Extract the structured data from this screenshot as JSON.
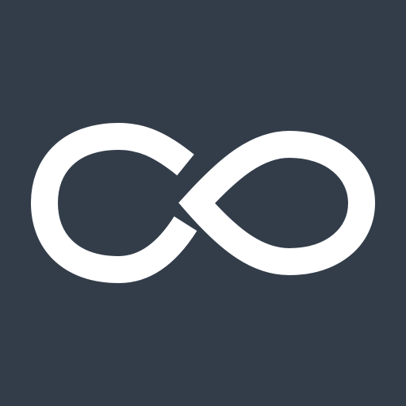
{
  "icon": {
    "name": "infinity-logo",
    "background_color": "#333d4a",
    "symbol_color": "#ffffff"
  }
}
